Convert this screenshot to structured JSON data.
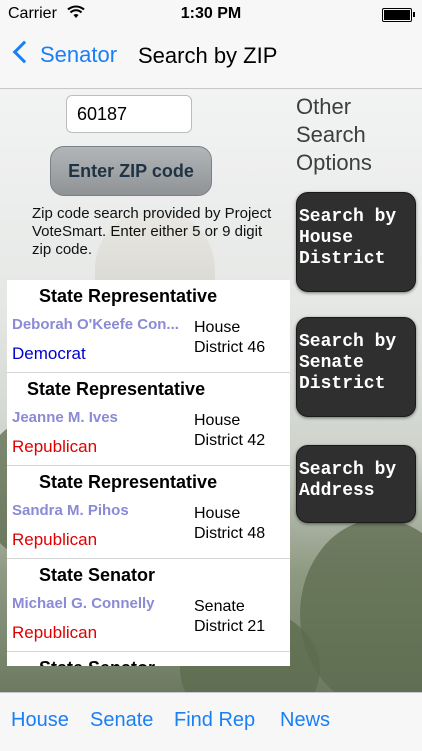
{
  "status": {
    "carrier": "Carrier",
    "time": "1:30 PM",
    "battery_level": 1.0
  },
  "nav": {
    "back_label": "Senator",
    "title": "Search by ZIP"
  },
  "zip": {
    "value": "60187",
    "button_label": "Enter ZIP code",
    "info": "Zip code search provided by Project VoteSmart.  Enter either 5 or 9 digit zip code."
  },
  "other": {
    "title": "Other Search Options",
    "buttons": [
      {
        "label": "Search by House District"
      },
      {
        "label": "Search by Senate District"
      },
      {
        "label": "Search by Address"
      }
    ]
  },
  "results": [
    {
      "role": "State Representative",
      "name": "Deborah O'Keefe Con...",
      "party": "Democrat",
      "district": "House District 46"
    },
    {
      "role": "State Representative",
      "name": "Jeanne M. Ives",
      "party": "Republican",
      "district": "House District 42"
    },
    {
      "role": "State Representative",
      "name": "Sandra M. Pihos",
      "party": "Republican",
      "district": "House District 48"
    },
    {
      "role": "State Senator",
      "name": "Michael G. Connelly",
      "party": "Republican",
      "district": "Senate District 21"
    },
    {
      "role": "State Senator",
      "name": "",
      "party": "",
      "district": ""
    }
  ],
  "tabs": [
    {
      "label": "House"
    },
    {
      "label": "Senate"
    },
    {
      "label": "Find Rep"
    },
    {
      "label": "News"
    }
  ],
  "colors": {
    "accent": "#1a7ff5",
    "democrat": "#0000cc",
    "republican": "#e00000",
    "name": "#8a8ad6"
  }
}
